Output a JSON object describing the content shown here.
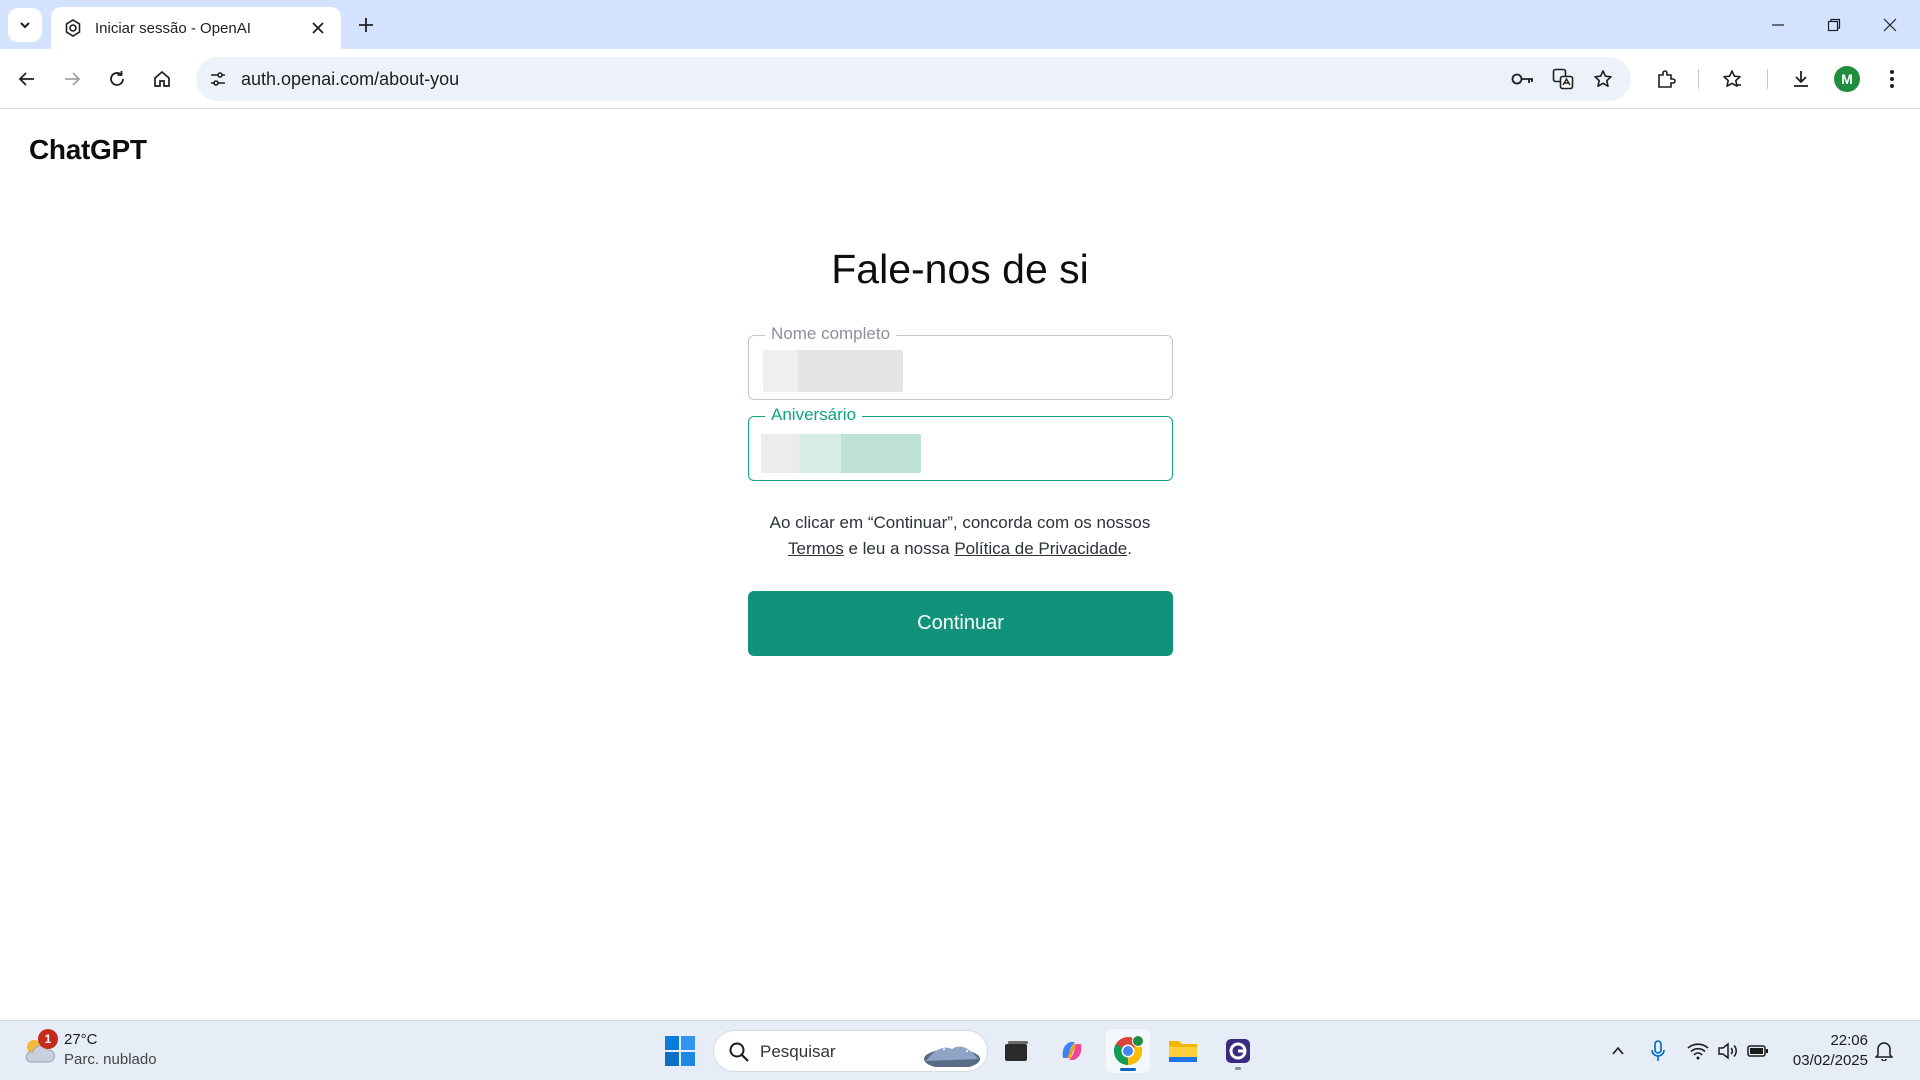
{
  "browser": {
    "tab": {
      "title": "Iniciar sessão - OpenAI",
      "favicon": "openai-icon"
    },
    "address": {
      "url": "auth.openai.com/about-you"
    },
    "profile_initial": "M",
    "accent": "#d3e3fd"
  },
  "page": {
    "brand": "ChatGPT",
    "heading": "Fale-nos de si",
    "fields": [
      {
        "label": "Nome completo",
        "focused": false
      },
      {
        "label": "Aniversário",
        "focused": true
      }
    ],
    "terms": {
      "before": "Ao clicar em “Continuar”, concorda com os nossos",
      "terms_link": "Termos",
      "middle": "e leu a nossa",
      "privacy_link": "Política de Privacidade",
      "after": "."
    },
    "continue_label": "Continuar",
    "colors": {
      "primary": "#10937a",
      "focus": "#10a37f"
    }
  },
  "taskbar": {
    "weather": {
      "badge": "1",
      "temp": "27°C",
      "desc": "Parc. nublado"
    },
    "search_placeholder": "Pesquisar",
    "apps": [
      "task-view-icon",
      "copilot-icon",
      "chrome-icon",
      "file-explorer-icon",
      "app-icon"
    ],
    "clock": {
      "time": "22:06",
      "date": "03/02/2025"
    }
  }
}
